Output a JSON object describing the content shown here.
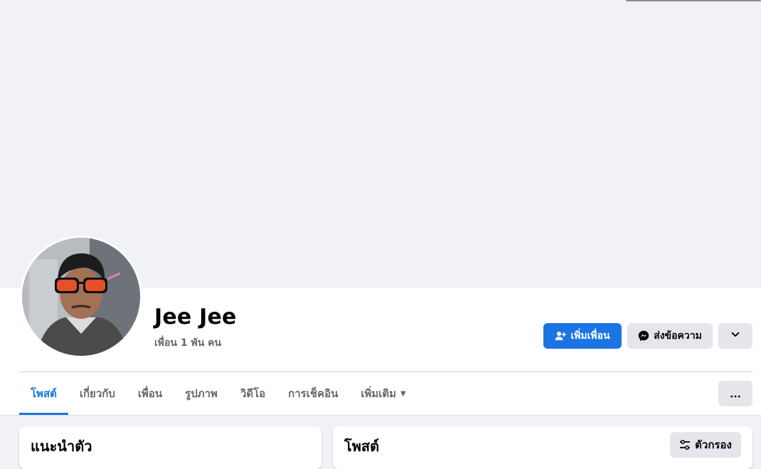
{
  "profile": {
    "name": "Jee Jee",
    "friends_text": "เพื่อน 1 พัน คน"
  },
  "actions": {
    "add_friend_label": "เพิ่มเพื่อน",
    "message_label": "ส่งข้อความ"
  },
  "tabs": [
    {
      "label": "โพสต์",
      "active": true
    },
    {
      "label": "เกี่ยวกับ"
    },
    {
      "label": "เพื่อน"
    },
    {
      "label": "รูปภาพ"
    },
    {
      "label": "วิดีโอ"
    },
    {
      "label": "การเช็คอิน"
    },
    {
      "label": "เพิ่มเติม"
    }
  ],
  "intro_card": {
    "title": "แนะนำตัว"
  },
  "posts_card": {
    "title": "โพสต์",
    "filter_label": "ตัวกรอง"
  },
  "colors": {
    "accent": "#1b74e4",
    "page_bg": "#f0f2f5",
    "secondary_button": "#e4e6eb",
    "muted_text": "#65676b"
  },
  "icons": [
    "add-friend-icon",
    "messenger-icon",
    "chevron-down-icon",
    "more-dots-icon",
    "filter-icon",
    "caret-down-icon"
  ]
}
